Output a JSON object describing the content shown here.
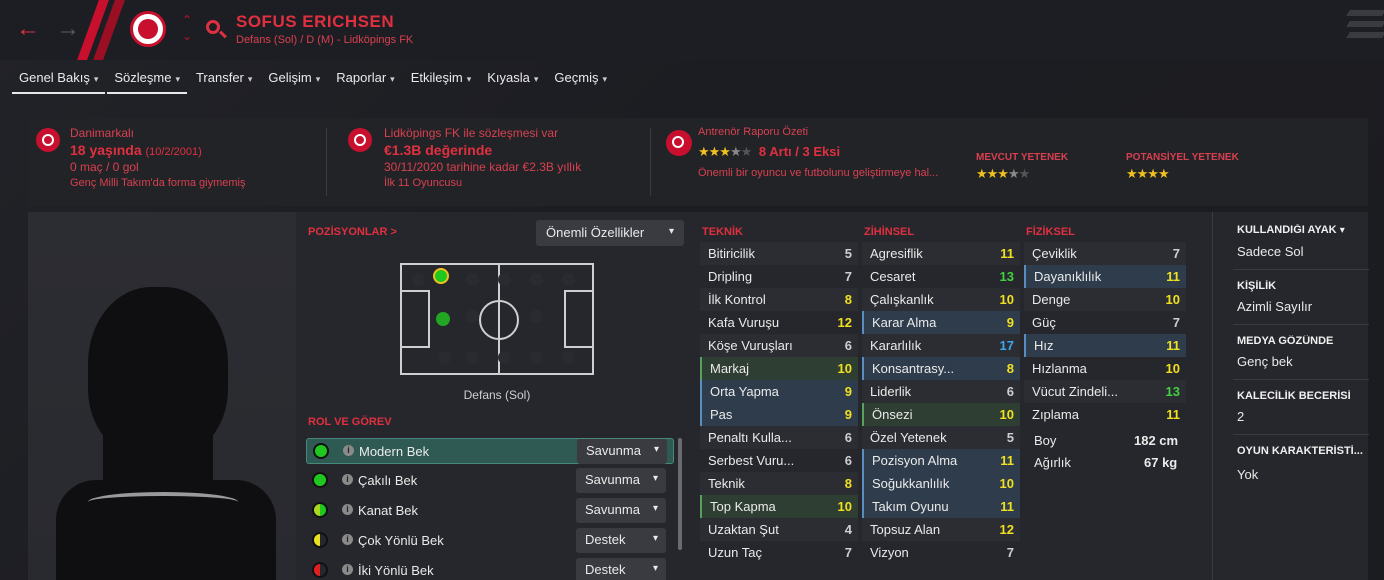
{
  "header": {
    "name": "SOFUS ERICHSEN",
    "subtitle": "Defans (Sol) / D (M) - Lidköpings FK",
    "back_glyph": "←",
    "forward_glyph": "→",
    "up_glyph": "⌃",
    "down_glyph": "⌄"
  },
  "tabs": [
    {
      "label": "Genel Bakış"
    },
    {
      "label": "Sözleşme"
    },
    {
      "label": "Transfer"
    },
    {
      "label": "Gelişim"
    },
    {
      "label": "Raporlar"
    },
    {
      "label": "Etkileşim"
    },
    {
      "label": "Kıyasla"
    },
    {
      "label": "Geçmiş"
    }
  ],
  "summary": {
    "nationality": "Danimarkalı",
    "age": "18 yaşında",
    "dob": "(10/2/2001)",
    "caps": "0 maç / 0 gol",
    "intl_note": "Genç Milli Takım'da forma giymemiş",
    "contract_title": "Lidköpings FK ile sözleşmesi var",
    "value": "€1.3B değerinde",
    "contract_until": "30/11/2020 tarihine kadar €2.3B yıllık",
    "squad_status": "İlk 11 Oyuncusu",
    "report_title": "Antrenör Raporu Özeti",
    "report_summary": "8 Artı / 3 Eksi",
    "report_text": "Önemli bir oyuncu ve futbolunu geliştirmeye hal...",
    "current_label": "MEVCUT YETENEK",
    "potential_label": "POTANSİYEL YETENEK",
    "report_stars": 3.5,
    "current_stars": 3.5,
    "potential_stars": 4
  },
  "positions": {
    "title": "POZİSYONLAR",
    "title_arrow": ">",
    "dropdown": "Önemli Özellikler",
    "caption": "Defans (Sol)"
  },
  "roles": {
    "title": "ROL VE GÖREV",
    "items": [
      {
        "name": "Modern Bek",
        "duty": "Savunma",
        "color": "#1ec81e"
      },
      {
        "name": "Çakılı Bek",
        "duty": "Savunma",
        "color": "#1ec81e"
      },
      {
        "name": "Kanat Bek",
        "duty": "Savunma",
        "color": "#a8d820"
      },
      {
        "name": "Çok Yönlü Bek",
        "duty": "Destek",
        "color": "#e8e020"
      },
      {
        "name": "İki Yönlü Bek",
        "duty": "Destek",
        "color": "#e02020"
      }
    ]
  },
  "attributes": {
    "technical_title": "TEKNİK",
    "mental_title": "ZİHİNSEL",
    "physical_title": "FİZİKSEL",
    "technical": [
      {
        "name": "Bitiricilik",
        "value": "5"
      },
      {
        "name": "Dripling",
        "value": "7"
      },
      {
        "name": "İlk Kontrol",
        "value": "8"
      },
      {
        "name": "Kafa Vuruşu",
        "value": "12"
      },
      {
        "name": "Köşe Vuruşları",
        "value": "6"
      },
      {
        "name": "Markaj",
        "value": "10"
      },
      {
        "name": "Orta Yapma",
        "value": "9"
      },
      {
        "name": "Pas",
        "value": "9"
      },
      {
        "name": "Penaltı Kulla...",
        "value": "6"
      },
      {
        "name": "Serbest Vuru...",
        "value": "6"
      },
      {
        "name": "Teknik",
        "value": "8"
      },
      {
        "name": "Top Kapma",
        "value": "10"
      },
      {
        "name": "Uzaktan Şut",
        "value": "4"
      },
      {
        "name": "Uzun Taç",
        "value": "7"
      }
    ],
    "mental": [
      {
        "name": "Agresiflik",
        "value": "11"
      },
      {
        "name": "Cesaret",
        "value": "13"
      },
      {
        "name": "Çalışkanlık",
        "value": "10"
      },
      {
        "name": "Karar Alma",
        "value": "9"
      },
      {
        "name": "Kararlılık",
        "value": "17"
      },
      {
        "name": "Konsantrasy...",
        "value": "8"
      },
      {
        "name": "Liderlik",
        "value": "6"
      },
      {
        "name": "Önsezi",
        "value": "10"
      },
      {
        "name": "Özel Yetenek",
        "value": "5"
      },
      {
        "name": "Pozisyon Alma",
        "value": "11"
      },
      {
        "name": "Soğukkanlılık",
        "value": "10"
      },
      {
        "name": "Takım Oyunu",
        "value": "11"
      },
      {
        "name": "Topsuz Alan",
        "value": "12"
      },
      {
        "name": "Vizyon",
        "value": "7"
      }
    ],
    "physical": [
      {
        "name": "Çeviklik",
        "value": "7"
      },
      {
        "name": "Dayanıklılık",
        "value": "11"
      },
      {
        "name": "Denge",
        "value": "10"
      },
      {
        "name": "Güç",
        "value": "7"
      },
      {
        "name": "Hız",
        "value": "11"
      },
      {
        "name": "Hızlanma",
        "value": "10"
      },
      {
        "name": "Vücut Zindeli...",
        "value": "13"
      },
      {
        "name": "Zıplama",
        "value": "11"
      }
    ],
    "height_label": "Boy",
    "height": "182 cm",
    "weight_label": "Ağırlık",
    "weight": "67 kg"
  },
  "info": {
    "foot_title": "KULLANDIĞI AYAK",
    "foot": "Sadece Sol",
    "personality_title": "KİŞİLİK",
    "personality": "Azimli Sayılır",
    "media_title": "MEDYA GÖZÜNDE",
    "media": "Genç bek",
    "gk_title": "KALECİLİK BECERİSİ",
    "gk": "2",
    "traits_title": "OYUN KARAKTERİSTİ...",
    "traits": "Yok"
  },
  "colors": {
    "accent_red": "#e03040",
    "attr_yellow": "#f0e020",
    "attr_green": "#40d040",
    "attr_blue": "#3aa8f0"
  }
}
